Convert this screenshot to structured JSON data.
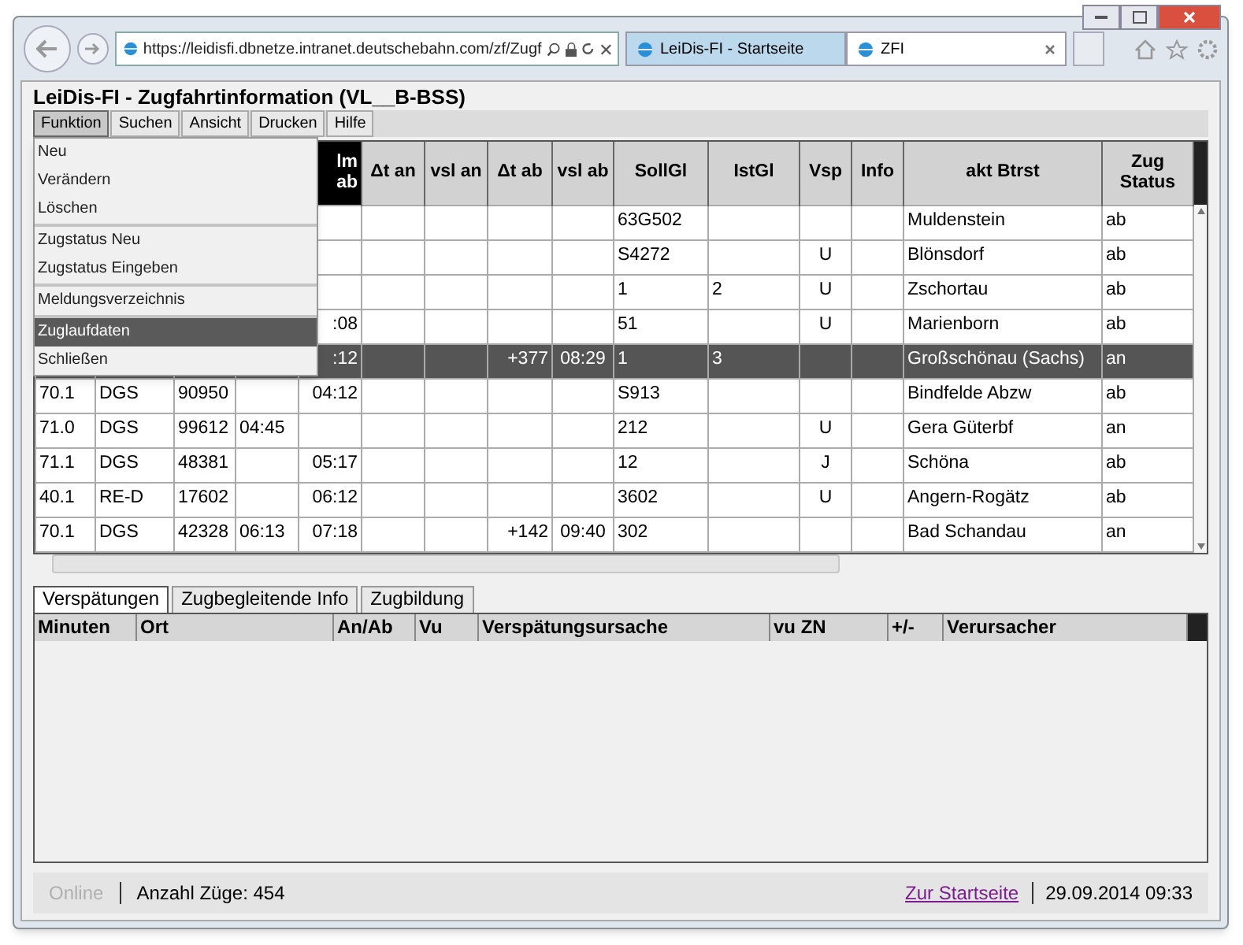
{
  "browser": {
    "address": "https://leidisfi.dbnetze.intranet.deutschebahn.com/zf/Zugf",
    "tabs": [
      {
        "label": "LeiDis-FI - Startseite",
        "selected": false
      },
      {
        "label": "ZFI",
        "selected": true
      }
    ]
  },
  "app_title": "LeiDis-FI - Zugfahrtinformation (VL__B-BSS)",
  "menubar": [
    {
      "label": "Funktion",
      "selected": true
    },
    {
      "label": "Suchen",
      "selected": false
    },
    {
      "label": "Ansicht",
      "selected": false
    },
    {
      "label": "Drucken",
      "selected": false
    },
    {
      "label": "Hilfe",
      "selected": false
    }
  ],
  "menu": [
    [
      {
        "label": "Neu",
        "selected": false
      },
      {
        "label": "Verändern",
        "selected": false
      },
      {
        "label": "Löschen",
        "selected": false
      }
    ],
    [
      {
        "label": "Zugstatus Neu",
        "selected": false
      },
      {
        "label": "Zugstatus Eingeben",
        "selected": false
      }
    ],
    [
      {
        "label": "Meldungsverzeichnis",
        "selected": false
      }
    ],
    [
      {
        "label": "Zuglaufdaten",
        "selected": true
      },
      {
        "label": "Schließen",
        "selected": false
      }
    ]
  ],
  "table": {
    "columns": [
      {},
      {},
      {},
      {},
      {
        "label": "lm ab",
        "sorted": true
      },
      {
        "label": "Δt an",
        "sorted": false
      },
      {
        "label": "vsl an",
        "sorted": false
      },
      {
        "label": "Δt ab",
        "sorted": false
      },
      {
        "label": "vsl ab",
        "sorted": false
      },
      {
        "label": "SollGl",
        "sorted": false
      },
      {
        "label": "IstGl",
        "sorted": false
      },
      {
        "label": "Vsp",
        "sorted": false
      },
      {
        "label": "Info",
        "sorted": false
      },
      {
        "label": "akt Btrst",
        "sorted": false
      },
      {
        "label": "Zug Status",
        "sorted": false
      }
    ],
    "rows": [
      {
        "selected": false,
        "cells": [
          null,
          null,
          null,
          null,
          null,
          null,
          null,
          null,
          null,
          "63G502",
          null,
          null,
          null,
          "Muldenstein",
          "ab"
        ]
      },
      {
        "selected": false,
        "cells": [
          null,
          null,
          null,
          null,
          null,
          null,
          null,
          null,
          null,
          "S4272",
          null,
          "U",
          null,
          "Blönsdorf",
          "ab"
        ]
      },
      {
        "selected": false,
        "cells": [
          null,
          null,
          null,
          null,
          null,
          null,
          null,
          null,
          null,
          "1",
          "2",
          "U",
          null,
          "Zschortau",
          "ab"
        ]
      },
      {
        "selected": false,
        "cells": [
          null,
          null,
          null,
          null,
          ":08",
          null,
          null,
          null,
          null,
          "51",
          null,
          "U",
          null,
          "Marienborn",
          "ab"
        ]
      },
      {
        "selected": true,
        "cells": [
          null,
          null,
          null,
          null,
          ":12",
          null,
          null,
          "+377",
          "08:29",
          "1",
          "3",
          null,
          null,
          "Großschönau (Sachs)",
          "an"
        ]
      },
      {
        "selected": false,
        "cells": [
          "70.1",
          "DGS",
          "90950",
          null,
          "04:12",
          null,
          null,
          null,
          null,
          "S913",
          null,
          null,
          null,
          "Bindfelde Abzw",
          "ab"
        ]
      },
      {
        "selected": false,
        "cells": [
          "71.0",
          "DGS",
          "99612",
          "04:45",
          null,
          null,
          null,
          null,
          null,
          "212",
          null,
          "U",
          null,
          "Gera Güterbf",
          "an"
        ]
      },
      {
        "selected": false,
        "cells": [
          "71.1",
          "DGS",
          "48381",
          null,
          "05:17",
          null,
          null,
          null,
          null,
          "12",
          null,
          "J",
          null,
          "Schöna",
          "ab"
        ]
      },
      {
        "selected": false,
        "cells": [
          "40.1",
          "RE-D",
          "17602",
          null,
          "06:12",
          null,
          null,
          null,
          null,
          "3602",
          null,
          "U",
          null,
          "Angern-Rogätz",
          "ab"
        ]
      },
      {
        "selected": false,
        "cells": [
          "70.1",
          "DGS",
          "42328",
          "06:13",
          "07:18",
          null,
          null,
          "+142",
          "09:40",
          "302",
          null,
          null,
          null,
          "Bad Schandau",
          "an"
        ]
      }
    ]
  },
  "detail_tabs": [
    {
      "label": "Verspätungen",
      "selected": true
    },
    {
      "label": "Zugbegleitende Info",
      "selected": false
    },
    {
      "label": "Zugbildung",
      "selected": false
    }
  ],
  "detail_columns": [
    "Minuten",
    "Ort",
    "An/Ab",
    "Vu",
    "Verspätungsursache",
    "vu ZN",
    "+/-",
    "Verursacher"
  ],
  "status_bar": {
    "connection": {
      "label": "Online",
      "disabled": true
    },
    "count": "Anzahl Züge: 454",
    "link": "Zur Startseite",
    "datetime": "29.09.2014 09:33"
  }
}
